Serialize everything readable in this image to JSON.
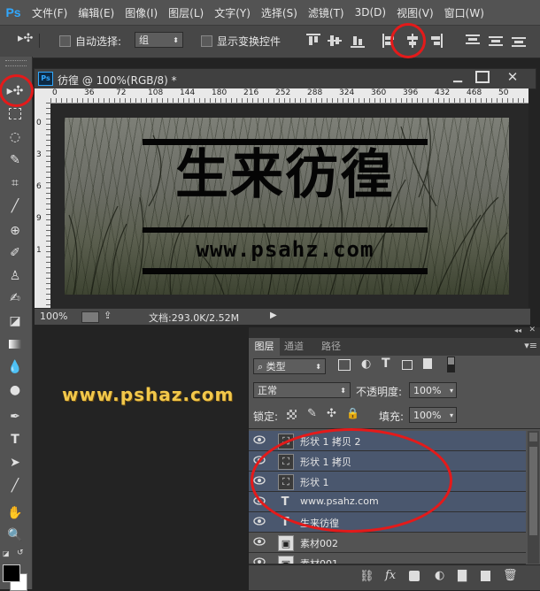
{
  "menu": [
    "文件(F)",
    "编辑(E)",
    "图像(I)",
    "图层(L)",
    "文字(Y)",
    "选择(S)",
    "滤镜(T)",
    "3D(D)",
    "视图(V)",
    "窗口(W)"
  ],
  "options_bar": {
    "auto_select_label": "自动选择:",
    "auto_select_value": "组",
    "show_transform_label": "显示变换控件"
  },
  "document": {
    "tab_title": "彷徨 @ 100%(RGB/8) *",
    "ruler_top_ticks": [
      "0",
      "36",
      "72",
      "108",
      "144",
      "180",
      "216",
      "252",
      "288",
      "324",
      "360",
      "396",
      "432",
      "468",
      "50"
    ],
    "ruler_left_ticks": [
      "0",
      "3",
      "6",
      "9",
      "1"
    ],
    "zoom": "100%",
    "doc_info": "文档:293.0K/2.52M"
  },
  "artwork": {
    "title": "生来彷徨",
    "url": "www.psahz.com"
  },
  "watermark": "www.pshaz.com",
  "layers_panel": {
    "tabs": [
      "图层",
      "通道",
      "路径"
    ],
    "filter_kind": "类型",
    "blend_mode": "正常",
    "opacity_label": "不透明度:",
    "opacity_value": "100%",
    "lock_label": "锁定:",
    "fill_label": "填充:",
    "fill_value": "100%",
    "layers": [
      {
        "name": "形状 1 拷贝 2",
        "type": "shape",
        "selected": true
      },
      {
        "name": "形状 1 拷贝",
        "type": "shape",
        "selected": true
      },
      {
        "name": "形状 1",
        "type": "shape",
        "selected": true
      },
      {
        "name": "www.psahz.com",
        "type": "text",
        "selected": true
      },
      {
        "name": "生来彷徨",
        "type": "text",
        "selected": true
      },
      {
        "name": "素材002",
        "type": "image",
        "selected": false
      },
      {
        "name": "素材001",
        "type": "image",
        "selected": false
      }
    ]
  },
  "colors": {
    "selection": "#4a576e",
    "highlight_ring": "#e41a1a",
    "watermark_text": "#f2c84b"
  }
}
